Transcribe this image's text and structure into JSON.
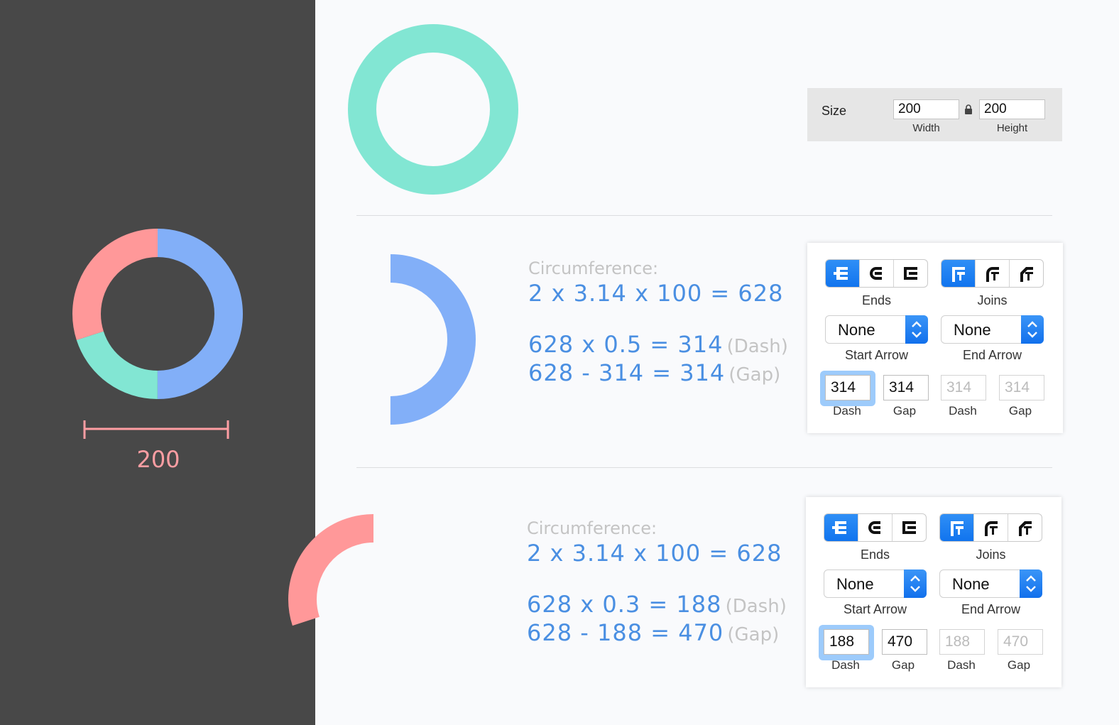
{
  "colors": {
    "blue": "#82aff8",
    "green": "#82e6d3",
    "red": "#ff9899",
    "formula_blue": "#4a8fe2",
    "accent": "#1a7cf0",
    "dark_bg": "#484848"
  },
  "sidebar": {
    "donut": {
      "segments": [
        {
          "name": "blue",
          "fraction": 0.5
        },
        {
          "name": "green",
          "fraction": 0.2
        },
        {
          "name": "red",
          "fraction": 0.3
        }
      ]
    },
    "measure_label": "200"
  },
  "size_panel": {
    "label": "Size",
    "width_value": "200",
    "height_value": "200",
    "width_caption": "Width",
    "height_caption": "Height",
    "lock_icon": "lock-icon"
  },
  "sections": [
    {
      "arc_fraction": 0.5,
      "title": "Circumference:",
      "line1": "2 x 3.14 x 100 = 628",
      "line2": "628 x 0.5 = 314",
      "line2_hint": "(Dash)",
      "line3": "628 - 314 = 314",
      "line3_hint": "(Gap)",
      "panel": {
        "ends_label": "Ends",
        "joins_label": "Joins",
        "start_arrow_value": "None",
        "end_arrow_value": "None",
        "start_arrow_label": "Start Arrow",
        "end_arrow_label": "End Arrow",
        "dash1": "314",
        "gap1": "314",
        "dash2": "314",
        "gap2": "314",
        "dash_label": "Dash",
        "gap_label": "Gap"
      }
    },
    {
      "arc_fraction": 0.3,
      "title": "Circumference:",
      "line1": "2 x 3.14 x 100 = 628",
      "line2": "628 x 0.3 = 188",
      "line2_hint": "(Dash)",
      "line3": "628 - 188 = 470",
      "line3_hint": "(Gap)",
      "panel": {
        "ends_label": "Ends",
        "joins_label": "Joins",
        "start_arrow_value": "None",
        "end_arrow_value": "None",
        "start_arrow_label": "Start Arrow",
        "end_arrow_label": "End Arrow",
        "dash1": "188",
        "gap1": "470",
        "dash2": "188",
        "gap2": "470",
        "dash_label": "Dash",
        "gap_label": "Gap"
      }
    }
  ]
}
